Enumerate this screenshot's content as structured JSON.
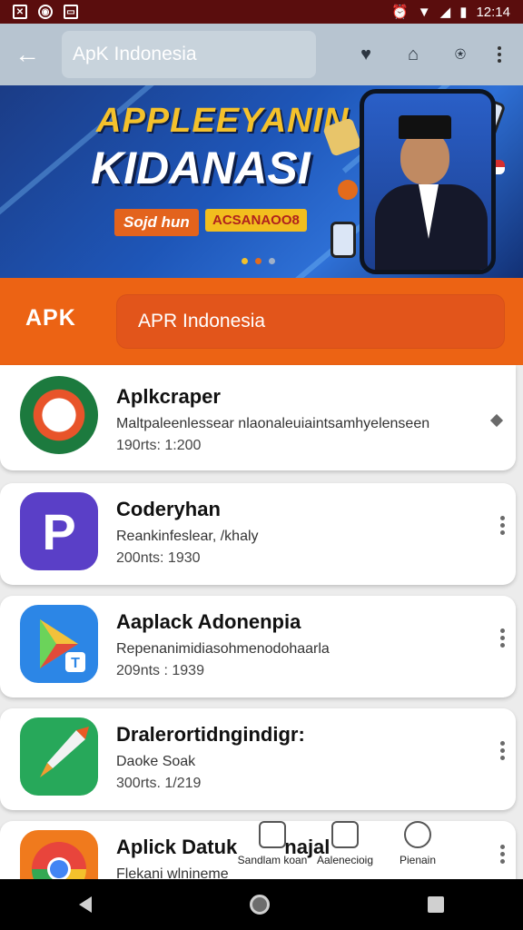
{
  "status_bar": {
    "time": "12:14",
    "left_icons": [
      "x-box-icon",
      "camera-icon",
      "image-icon"
    ],
    "right_icons": [
      "alarm-icon",
      "wifi-icon",
      "signal-icon",
      "battery-icon"
    ]
  },
  "app_bar": {
    "title": "ApK Indonesia",
    "icons": [
      "heart-icon",
      "store-icon",
      "notification-icon",
      "more-icon"
    ]
  },
  "banner": {
    "line1": "APPLEEYANIN",
    "line2": "KIDANASI",
    "tag1": "Sojd hun",
    "tag2": "ACSANAOO8"
  },
  "brand": {
    "logo": "APK",
    "name": "APR Indonesia"
  },
  "apps": [
    {
      "name": "Aplkcraper",
      "desc": "Maltpaleenlessear nlaonaleuiaintsamhyelenseen",
      "meta": "190rts: 1:200"
    },
    {
      "name": "Coderyhan",
      "desc": "Reankinfeslear, /khaly",
      "meta": "200nts: 1930"
    },
    {
      "name": "Aaplack Adonenpia",
      "desc": "Repenanimidiasohmenodohaarla",
      "meta": "209nts : 1939"
    },
    {
      "name": "Dralerortidngindigr:",
      "desc": "Daoke Soak",
      "meta": "300rts. 1/219"
    },
    {
      "name": "Aplick Datuk",
      "name2": "najal",
      "desc": "Flekani wlnineme",
      "meta": ""
    }
  ],
  "overlay_actions": [
    {
      "label": "Sandlam koan"
    },
    {
      "label": "Aalenecioig"
    },
    {
      "label": "Pienain"
    }
  ],
  "colors": {
    "status": "#5a0d0d",
    "appbar": "#b7c4d0",
    "orange": "#ec6314",
    "accent_yellow": "#f4c12c"
  }
}
